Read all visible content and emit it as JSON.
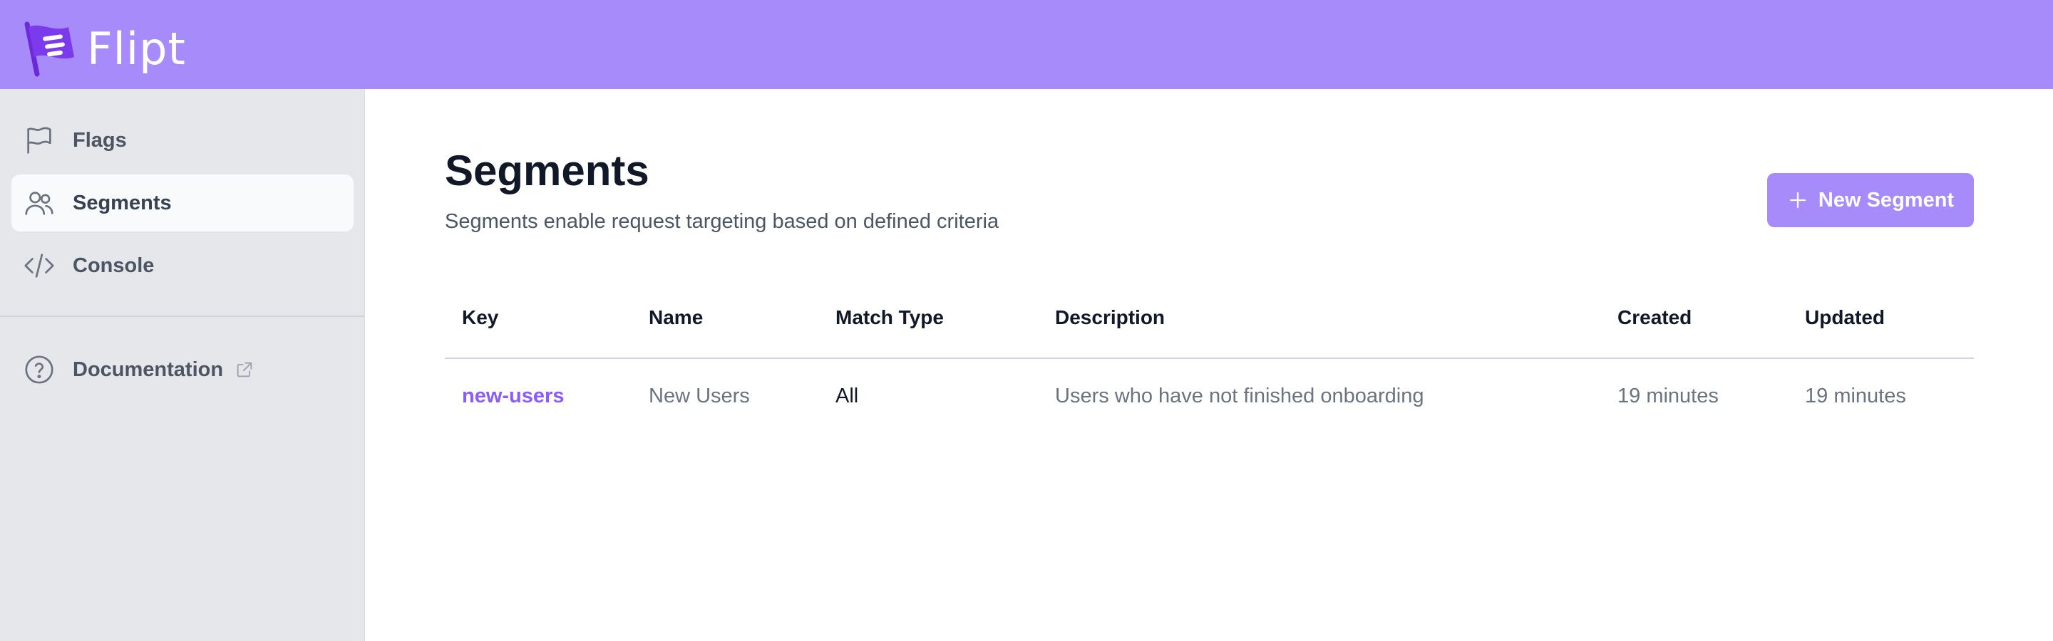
{
  "app": {
    "name": "Flipt",
    "brand_color": "#a78bfa",
    "logo_icon": "flag-logo-icon"
  },
  "sidebar": {
    "items": [
      {
        "label": "Flags",
        "icon": "flag-icon",
        "active": false
      },
      {
        "label": "Segments",
        "icon": "users-icon",
        "active": true
      },
      {
        "label": "Console",
        "icon": "code-icon",
        "active": false
      },
      {
        "label": "Documentation",
        "icon": "question-circle-icon",
        "external_icon": "external-link-icon",
        "active": false
      }
    ]
  },
  "page": {
    "title": "Segments",
    "subtitle": "Segments enable request targeting based on defined criteria",
    "new_button_label": "New Segment",
    "new_button_icon": "plus-icon"
  },
  "table": {
    "columns": [
      "Key",
      "Name",
      "Match Type",
      "Description",
      "Created",
      "Updated"
    ],
    "rows": [
      {
        "key": "new-users",
        "name": "New Users",
        "match_type": "All",
        "description": "Users who have not finished onboarding",
        "created": "19 minutes",
        "updated": "19 minutes"
      }
    ]
  },
  "colors": {
    "accent": "#a78bfa",
    "link": "#8b5cf6",
    "sidebar_bg": "#e5e7eb"
  }
}
